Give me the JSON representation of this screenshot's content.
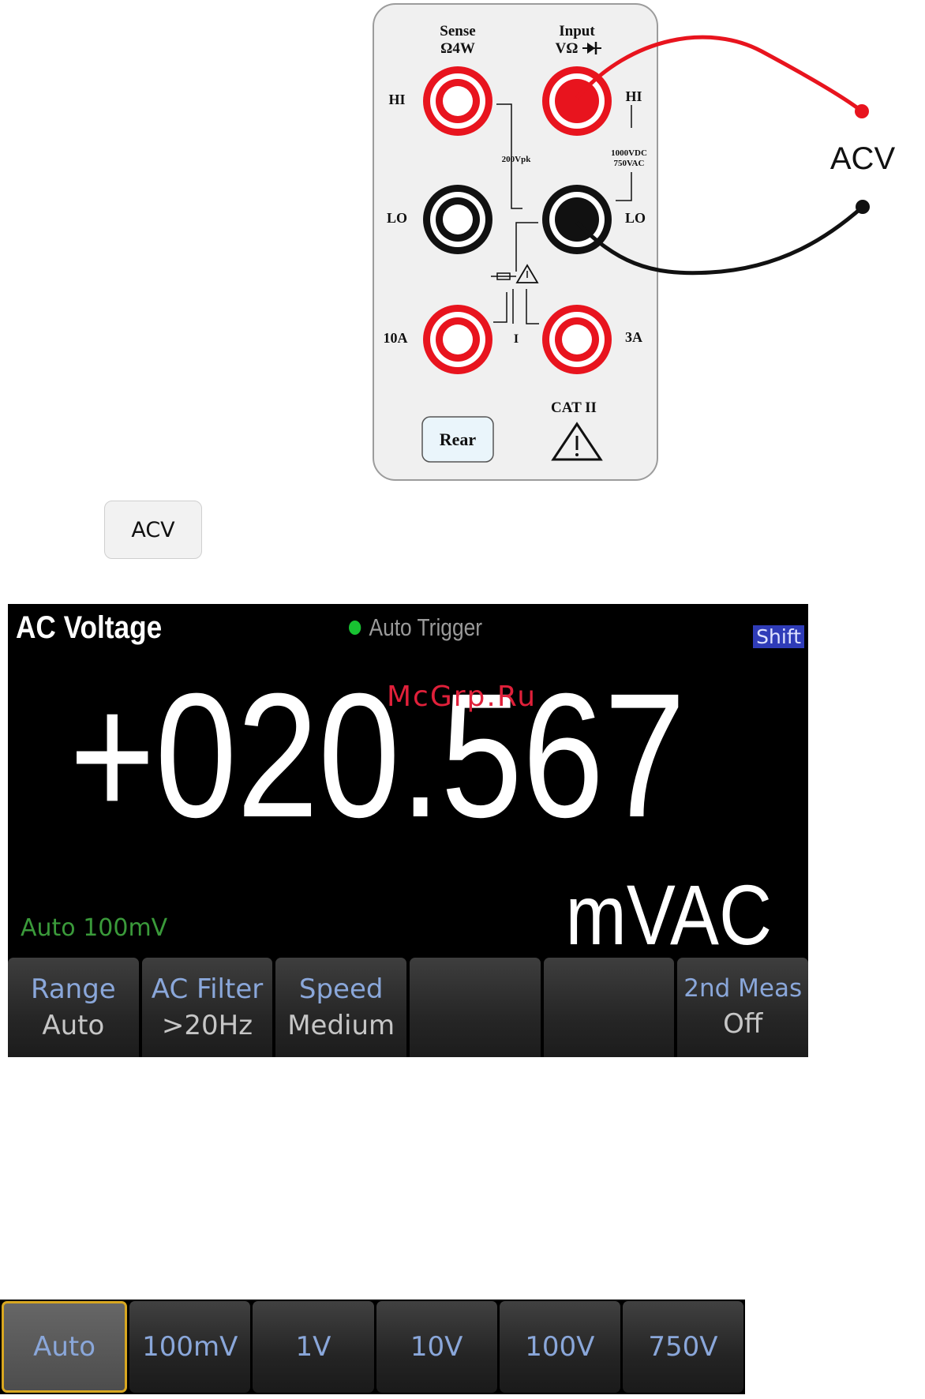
{
  "front_panel": {
    "sense_label": "Sense",
    "sense_sub": "Ω4W",
    "input_label": "Input",
    "input_sub": "VΩ",
    "hi_left": "HI",
    "hi_right": "HI",
    "lo_left": "LO",
    "lo_right": "LO",
    "vpk_label": "200Vpk",
    "rating_line1": "1000VDC",
    "rating_line2": "750VAC",
    "current_10a": "10A",
    "current_3a": "3A",
    "current_i": "I",
    "cat_label": "CAT II",
    "rear_button": "Rear",
    "probe_label": "ACV",
    "colors": {
      "red": "#e8141e",
      "black": "#111111",
      "panel_bg": "#f0f0f0"
    }
  },
  "key": {
    "label": "ACV"
  },
  "screen": {
    "function_title": "AC Voltage",
    "trigger_status": "Auto Trigger",
    "shift_badge": "Shift",
    "reading": "+020.567",
    "unit": "mVAC",
    "range_status": "Auto 100mV",
    "softkeys": [
      {
        "top": "Range",
        "bottom": "Auto"
      },
      {
        "top": "AC Filter",
        "bottom": ">20Hz"
      },
      {
        "top": "Speed",
        "bottom": "Medium"
      },
      {
        "top": "",
        "bottom": ""
      },
      {
        "top": "",
        "bottom": ""
      },
      {
        "top": "2nd Meas",
        "bottom": "Off"
      }
    ]
  },
  "range_menu": {
    "options": [
      "Auto",
      "100mV",
      "1V",
      "10V",
      "100V",
      "750V"
    ],
    "selected": "Auto"
  },
  "watermark": "McGrp.Ru"
}
